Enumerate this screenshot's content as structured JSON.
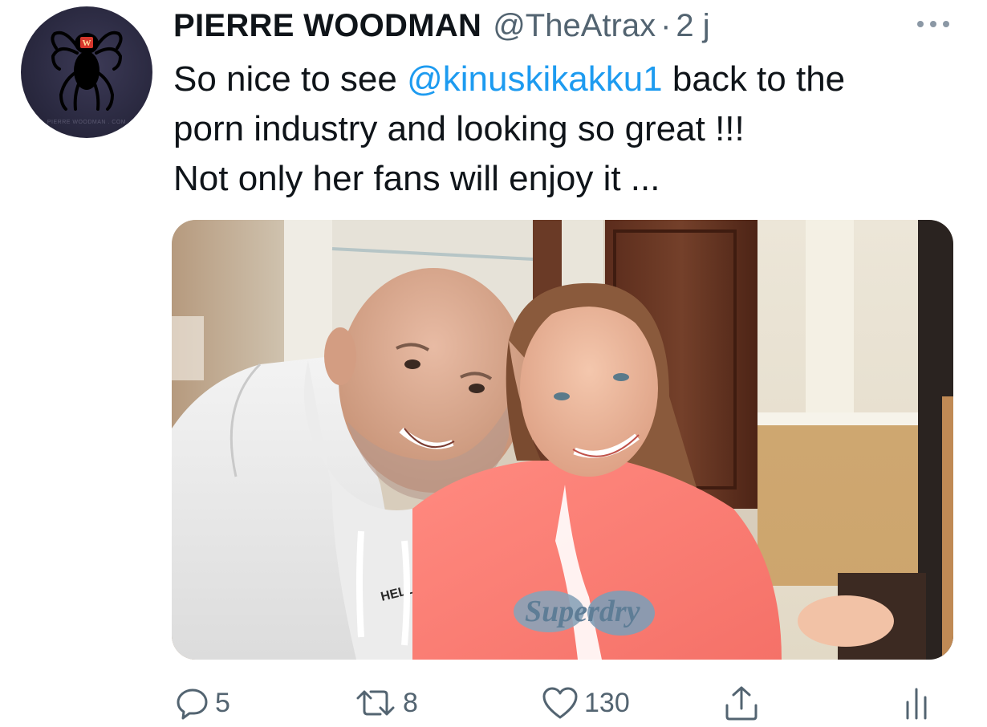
{
  "tweet": {
    "author": {
      "display_name": "PIERRE WOODMAN",
      "handle": "@TheAtrax",
      "separator": "·",
      "time": "2 j",
      "avatar_logo_letter": "W",
      "avatar_logo_text": "PIERRE WOODMAN . COM",
      "avatar_icon": "spider-logo"
    },
    "text": {
      "line1_before": "So nice to see ",
      "mention": "@kinuskikakku1",
      "line1_after": " back to the",
      "line2": "porn industry and looking so great !!!",
      "line3": "Not only her fans will enjoy it ..."
    },
    "media": {
      "kind": "photo",
      "sweater_print": "HELL",
      "sweater_logo": "Superdry"
    },
    "actions": {
      "reply": {
        "icon": "reply-icon",
        "count": "5"
      },
      "retweet": {
        "icon": "retweet-icon",
        "count": "8"
      },
      "like": {
        "icon": "heart-icon",
        "count": "130"
      },
      "share": {
        "icon": "share-icon"
      },
      "analytics": {
        "icon": "analytics-icon"
      }
    },
    "more_icon": "more-dots-icon"
  },
  "colors": {
    "text": "#0f1419",
    "secondary": "#536471",
    "link": "#1d9bf0",
    "avatar_bg": "#2a2940",
    "logo_red": "#d7372c"
  }
}
